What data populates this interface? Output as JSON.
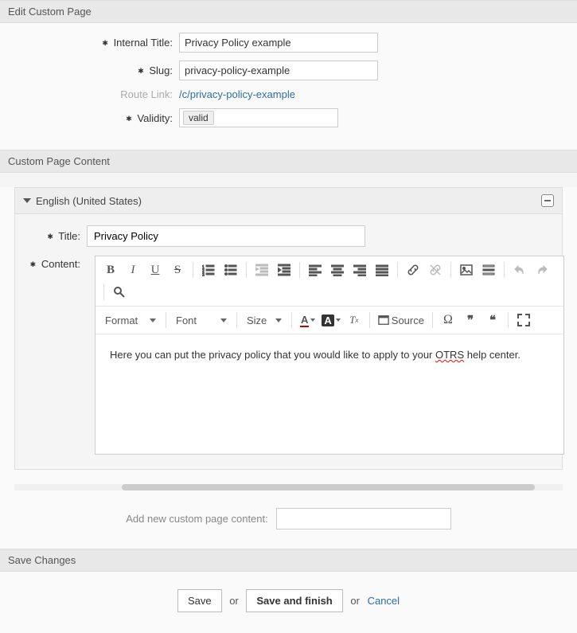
{
  "section_edit": {
    "header": "Edit Custom Page",
    "internal_title_label": "Internal Title:",
    "internal_title_value": "Privacy Policy example",
    "slug_label": "Slug:",
    "slug_value": "privacy-policy-example",
    "route_link_label": "Route Link:",
    "route_link_value": "/c/privacy-policy-example",
    "validity_label": "Validity:",
    "validity_value": "valid"
  },
  "section_content": {
    "header": "Custom Page Content",
    "lang_name": "English (United States)",
    "title_label": "Title:",
    "title_value": "Privacy Policy",
    "content_label": "Content:",
    "editor": {
      "format_label": "Format",
      "font_label": "Font",
      "size_label": "Size",
      "source_label": "Source",
      "body_pre": "Here you can put the privacy policy that you would like to apply to your ",
      "body_err": "OTRS",
      "body_post": " help center."
    },
    "add_label": "Add new custom page content:"
  },
  "section_save": {
    "header": "Save Changes",
    "save": "Save",
    "or1": "or",
    "save_finish": "Save and finish",
    "or2": "or",
    "cancel": "Cancel"
  }
}
